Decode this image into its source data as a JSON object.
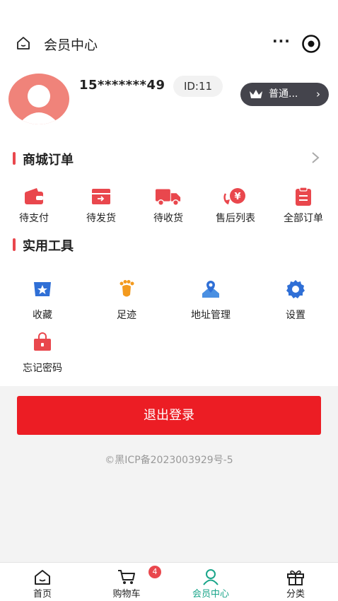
{
  "header": {
    "title": "会员中心",
    "more_icon": "more-dots-icon",
    "target_icon": "target-icon",
    "home_icon": "home-icon"
  },
  "user": {
    "phone": "15*******49",
    "id_label": "ID:11",
    "vip_label": "普通...",
    "vip_arrow": "›"
  },
  "orders": {
    "title": "商城订单",
    "items": [
      {
        "label": "待支付",
        "icon": "wallet-icon"
      },
      {
        "label": "待发货",
        "icon": "box-icon"
      },
      {
        "label": "待收货",
        "icon": "truck-icon"
      },
      {
        "label": "售后列表",
        "icon": "refund-icon"
      },
      {
        "label": "全部订单",
        "icon": "clipboard-icon"
      }
    ]
  },
  "tools": {
    "title": "实用工具",
    "items": [
      {
        "label": "收藏",
        "icon": "star-bookmark-icon"
      },
      {
        "label": "足迹",
        "icon": "footprint-icon"
      },
      {
        "label": "地址管理",
        "icon": "map-icon"
      },
      {
        "label": "设置",
        "icon": "gear-icon"
      },
      {
        "label": "忘记密码",
        "icon": "lock-bag-icon"
      }
    ]
  },
  "logout_label": "退出登录",
  "icp": "©黑ICP备2023003929号-5",
  "tabbar": {
    "items": [
      {
        "label": "首页",
        "icon": "home-icon"
      },
      {
        "label": "购物车",
        "icon": "cart-icon"
      },
      {
        "label": "会员中心",
        "icon": "user-icon"
      },
      {
        "label": "分类",
        "icon": "gift-icon"
      }
    ],
    "cart_badge": "4"
  },
  "colors": {
    "accent": "#ec1d24",
    "active_tab": "#1aa58a",
    "vip_bg": "#44444c"
  }
}
